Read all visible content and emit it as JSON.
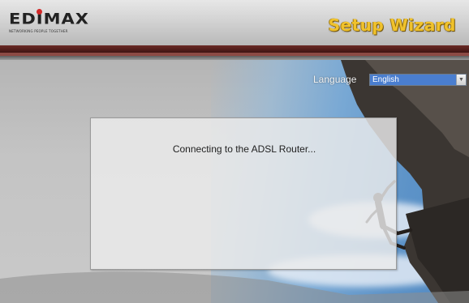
{
  "header": {
    "brand": {
      "name": "EDIMAX",
      "tagline": "NETWORKING PEOPLE TOGETHER",
      "dot_color": "#d22828"
    },
    "title": "Setup Wizard",
    "title_color": "#f0c22c",
    "stripe_color": "#5a1f1c"
  },
  "language": {
    "label": "Language",
    "selected": "English",
    "arrow_icon": "chevron-down-icon"
  },
  "dialog": {
    "status": "Connecting to the ADSL Router..."
  }
}
